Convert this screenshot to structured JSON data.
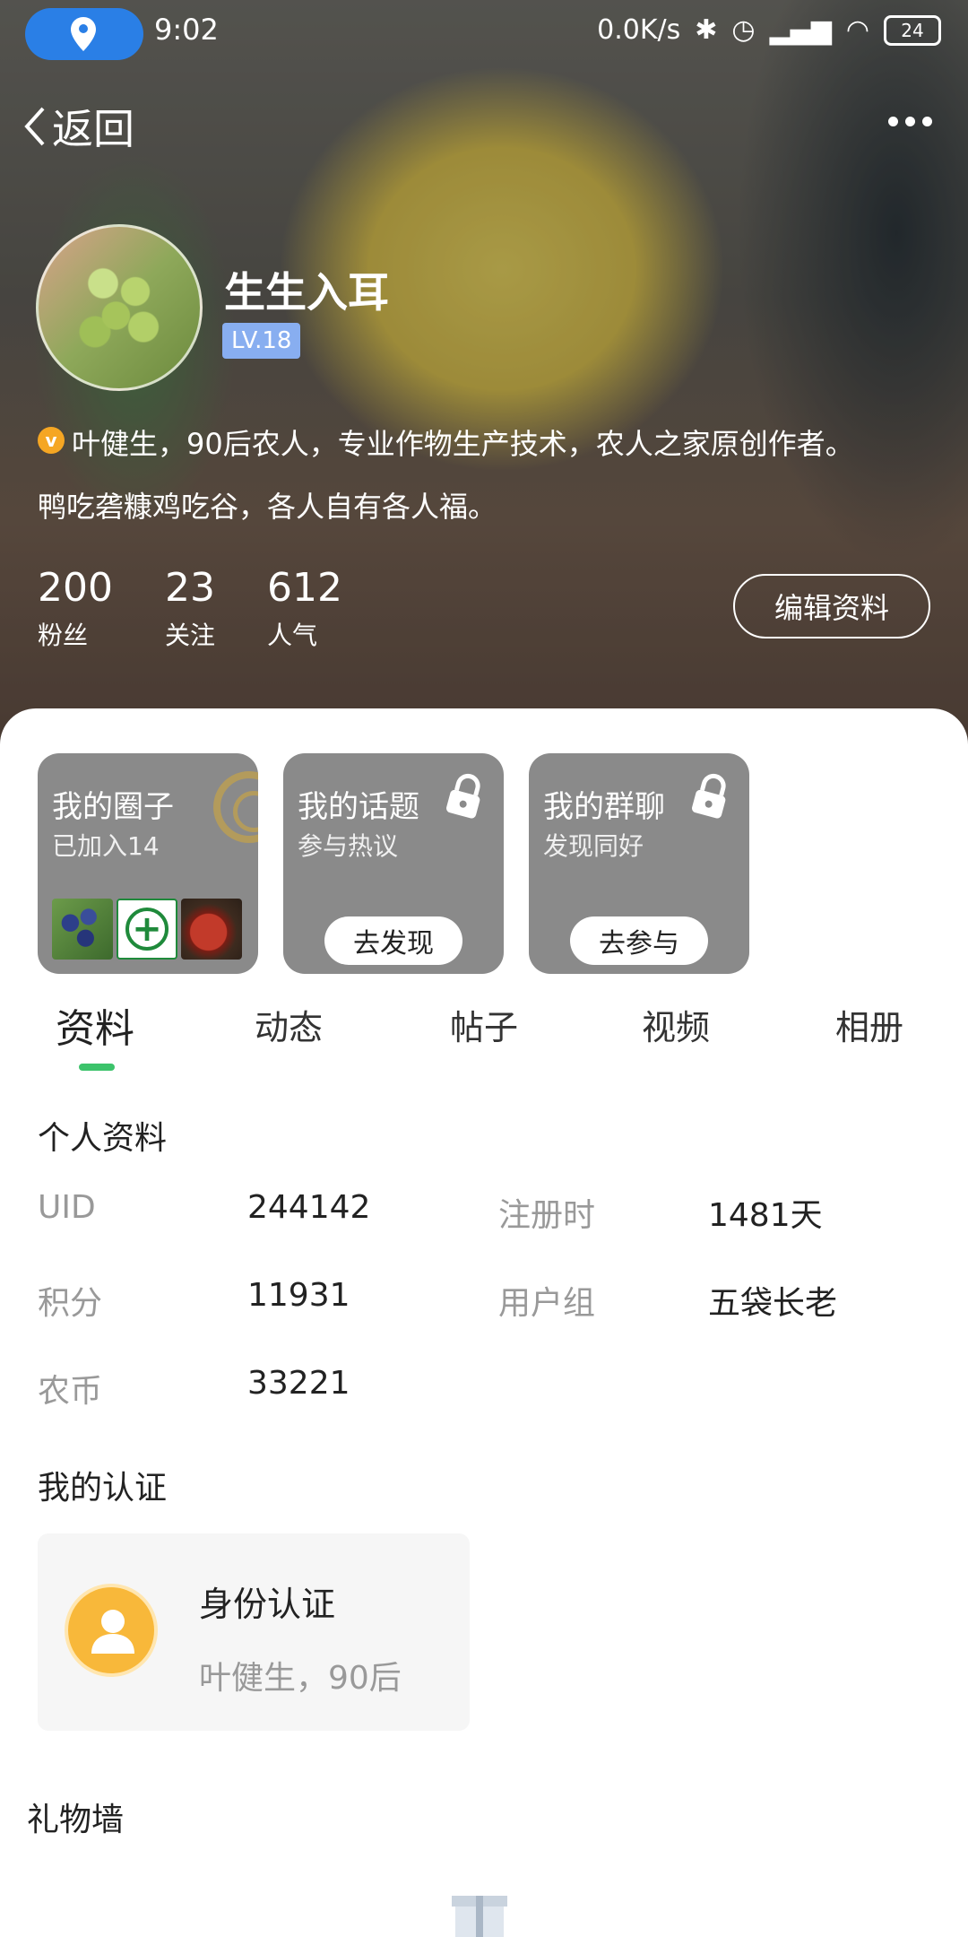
{
  "status_bar": {
    "time": "9:02",
    "network_speed": "0.0K/s",
    "battery": "24"
  },
  "header": {
    "back_label": "返回",
    "username": "生生入耳",
    "level": "LV.18",
    "bio_line1": "叶健生，90后农人，专业作物生产技术，农人之家原创作者。",
    "bio_line2": "鸭吃砻糠鸡吃谷，各人自有各人福。",
    "edit_button": "编辑资料",
    "stats": [
      {
        "num": "200",
        "label": "粉丝"
      },
      {
        "num": "23",
        "label": "关注"
      },
      {
        "num": "612",
        "label": "人气"
      }
    ]
  },
  "cards": [
    {
      "title": "我的圈子",
      "sub": "已加入14"
    },
    {
      "title": "我的话题",
      "sub": "参与热议",
      "button": "去发现"
    },
    {
      "title": "我的群聊",
      "sub": "发现同好",
      "button": "去参与"
    }
  ],
  "tabs": [
    "资料",
    "动态",
    "帖子",
    "视频",
    "相册"
  ],
  "profile": {
    "section_title": "个人资料",
    "rows": [
      {
        "label": "UID",
        "value": "244142"
      },
      {
        "label": "注册时",
        "value": "1481天"
      },
      {
        "label": "积分",
        "value": "11931"
      },
      {
        "label": "用户组",
        "value": "五袋长老"
      },
      {
        "label": "农币",
        "value": "33221"
      }
    ]
  },
  "certification": {
    "section_title": "我的认证",
    "card_title": "身份认证",
    "card_sub": "叶健生，90后"
  },
  "gifts": {
    "section_title": "礼物墙"
  },
  "colors": {
    "accent_green": "#3cc36b",
    "level_badge": "#88aef0",
    "location_pill": "#2a7fe6",
    "auth_avatar": "#f8b83a"
  }
}
